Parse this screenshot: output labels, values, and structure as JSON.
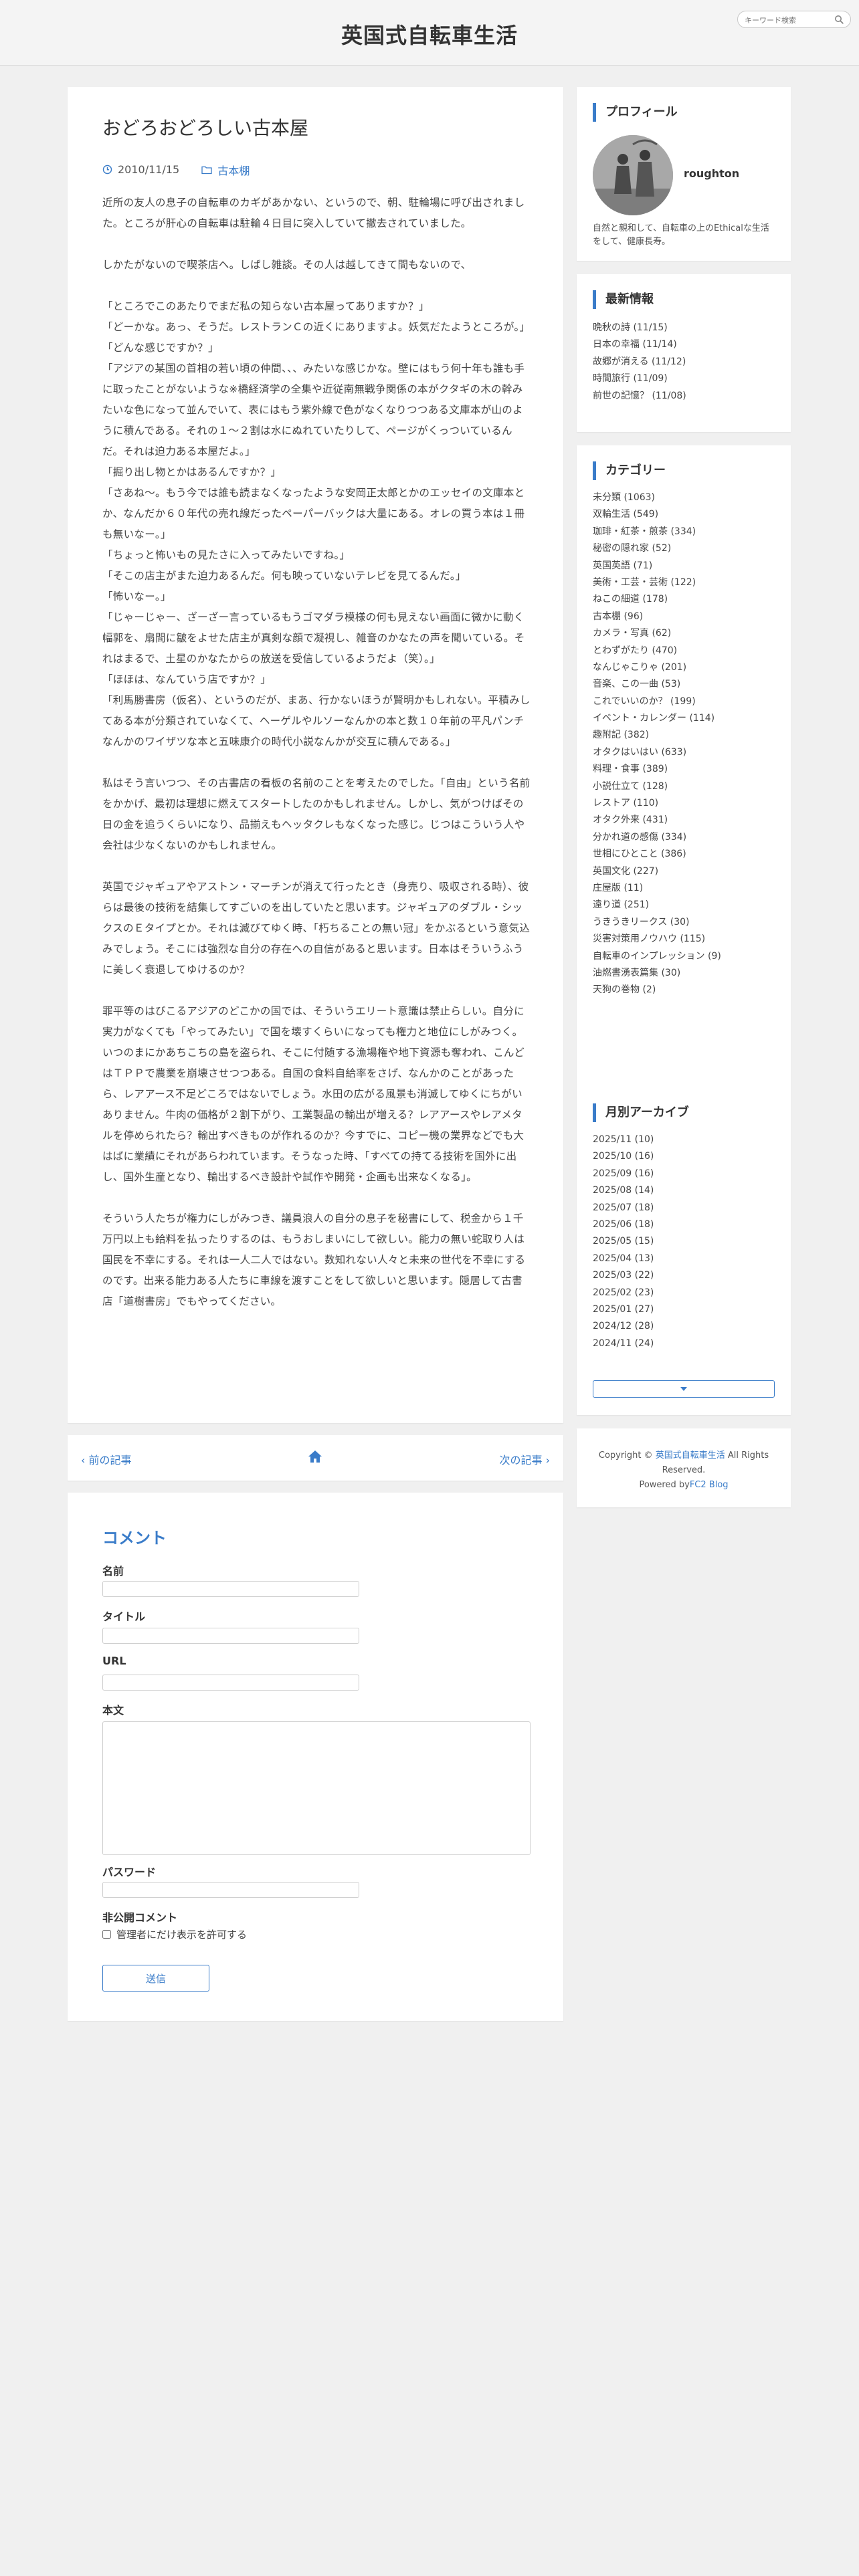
{
  "header": {
    "site_title": "英国式自転車生活",
    "search_placeholder": "キーワード検索"
  },
  "post": {
    "title": "おどろおどろしい古本屋",
    "date": "2010/11/15",
    "category": "古本棚",
    "paragraphs": [
      "近所の友人の息子の自転車のカギがあかない、というので、朝、駐輪場に呼び出されました。ところが肝心の自転車は駐輪４日目に突入していて撤去されていました。",
      "しかたがないので喫茶店へ。しばし雑談。その人は越してきて間もないので、"
    ],
    "dialog": [
      "「ところでこのあたりでまだ私の知らない古本屋ってありますか？」",
      "「どーかな。あっ、そうだ。レストランＣの近くにありますよ。妖気だたようところが。」",
      "「どんな感じですか？」",
      "「アジアの某国の首相の若い頃の仲間、、、みたいな感じかな。壁にはもう何十年も誰も手に取ったことがないような※橋経済学の全集や近従南無戦争関係の本がクタギの木の幹みたいな色になって並んでいて、表にはもう紫外線で色がなくなりつつある文庫本が山のように積んである。それの１〜２割は水にぬれていたりして、ページがくっついているんだ。それは迫力ある本屋だよ。」",
      "「掘り出し物とかはあるんですか？」",
      "「さあね〜。もう今では誰も読まなくなったような安岡正太郎とかのエッセイの文庫本とか、なんだか６０年代の売れ線だったペーパーバックは大量にある。オレの買う本は１冊も無いなー。」",
      "「ちょっと怖いもの見たさに入ってみたいですね。」",
      "「そこの店主がまた迫力あるんだ。何も映っていないテレビを見てるんだ。」",
      "「怖いなー。」",
      "「じゃーじゃー、ざーざー言っているもうゴマダラ模様の何も見えない画面に微かに動く幅郭を、扇間に皺をよせた店主が真剣な顔で凝視し、雑音のかなたの声を聞いている。それはまるで、土星のかなたからの放送を受信しているようだよ（笑）。」",
      "「ほほは、なんていう店ですか？」",
      "「利馬勝書房（仮名）、というのだが、まあ、行かないほうが賢明かもしれない。平積みしてある本が分類されていなくて、ヘーゲルやルソーなんかの本と数１０年前の平凡パンチなんかのワイザツな本と五味康介の時代小説なんかが交互に積んである。」"
    ],
    "paragraphs_after": [
      "私はそう言いつつ、その古書店の看板の名前のことを考えたのでした。「自由」という名前をかかげ、最初は理想に燃えてスタートしたのかもしれません。しかし、気がつけばその日の金を追うくらいになり、品揃えもヘッタクレもなくなった感じ。じつはこういう人や会社は少なくないのかもしれません。",
      "英国でジャギュアやアストン・マーチンが消えて行ったとき（身売り、吸収される時）、彼らは最後の技術を結集してすごいのを出していたと思います。ジャギュアのダブル・シックスのＥタイプとか。それは滅びてゆく時、「朽ちることの無い冠」をかぶるという意気込みでしょう。そこには強烈な自分の存在への自信があると思います。日本はそういうふうに美しく衰退してゆけるのか？",
      "罪平等のはびこるアジアのどこかの国では、そういうエリート意識は禁止らしい。自分に実力がなくても「やってみたい」で国を壊すくらいになっても権力と地位にしがみつく。いつのまにかあちこちの島を盗られ、そこに付随する漁場権や地下資源も奪われ、こんどはＴＰＰで農業を崩壊させつつある。自国の食料自給率をさげ、なんかのことがあったら、レアアース不足どころではないでしょう。水田の広がる風景も消滅してゆくにちがいありません。牛肉の価格が２割下がり、工業製品の輸出が増える？レアアースやレアメタルを停められたら？輸出すべきものが作れるのか？今すでに、コピー機の業界などでも大はばに業績にそれがあらわれています。そうなった時、「すべての持てる技術を国外に出し、国外生産となり、輸出するべき設計や試作や開発・企画も出来なくなる」。",
      "そういう人たちが権力にしがみつき、議員浪人の自分の息子を秘書にして、税金から１千万円以上も給料を払ったりするのは、もうおしまいにして欲しい。能力の無い蛇取り人は国民を不幸にする。それは一人二人ではない。数知れない人々と未来の世代を不幸にするのです。出来る能力ある人たちに車線を渡すことをして欲しいと思います。隠居して古書店「道樹書房」でもやってください。"
    ]
  },
  "pager": {
    "prev_label": "前の記事",
    "next_label": "次の記事"
  },
  "comment_form": {
    "heading": "コメント",
    "name_label": "名前",
    "title_label": "タイトル",
    "url_label": "URL",
    "body_label": "本文",
    "password_label": "パスワード",
    "private_label": "非公開コメント",
    "private_checkbox_label": "管理者にだけ表示を許可する",
    "submit_label": "送信"
  },
  "sidebar": {
    "profile": {
      "title": "プロフィール",
      "name": "roughton",
      "description": "自然と親和して、自転車の上のEthicalな生活をして、健康長寿。"
    },
    "recent": {
      "title": "最新情報",
      "items": [
        "晩秋の詩 (11/15)",
        "日本の幸福 (11/14)",
        "故郷が消える (11/12)",
        "時間旅行 (11/09)",
        "前世の記憶？ (11/08)"
      ]
    },
    "categories": {
      "title": "カテゴリー",
      "items": [
        "未分類 (1063)",
        "双輪生活 (549)",
        "珈琲・紅茶・煎茶 (334)",
        "秘密の隠れ家 (52)",
        "英国英語 (71)",
        "美術・工芸・芸術 (122)",
        "ねこの細道 (178)",
        "古本棚 (96)",
        "カメラ・写真 (62)",
        "とわずがたり (470)",
        "なんじゃこりゃ (201)",
        "音楽、この一曲 (53)",
        "これでいいのか？ (199)",
        "イベント・カレンダー (114)",
        "趣附記 (382)",
        "オタクはいはい (633)",
        "料理・食事 (389)",
        "小説仕立て (128)",
        "レストア (110)",
        "オタク外来 (431)",
        "分かれ道の感傷 (334)",
        "世相にひとこと (386)",
        "英国文化 (227)",
        "庄屋版 (11)",
        "遠り道 (251)",
        "うきうきリークス (30)",
        "災害対策用ノウハウ (115)",
        "自転車のインプレッション (9)",
        "油燃書湧表篇集 (30)",
        "天狗の巻物 (2)"
      ]
    },
    "archive": {
      "title": "月別アーカイブ",
      "items": [
        "2025/11 (10)",
        "2025/10 (16)",
        "2025/09 (16)",
        "2025/08 (14)",
        "2025/07 (18)",
        "2025/06 (18)",
        "2025/05 (15)",
        "2025/04 (13)",
        "2025/03 (22)",
        "2025/02 (23)",
        "2025/01 (27)",
        "2024/12 (28)",
        "2024/11 (24)"
      ]
    },
    "footer": {
      "copyright_prefix": "Copyright ©",
      "site_link": "英国式自転車生活",
      "rights": "All Rights Reserved.",
      "powered_prefix": "Powered by",
      "powered_link": "FC2 Blog"
    }
  },
  "colors": {
    "accent": "#3a7cc9",
    "background": "#f0f0f0"
  }
}
